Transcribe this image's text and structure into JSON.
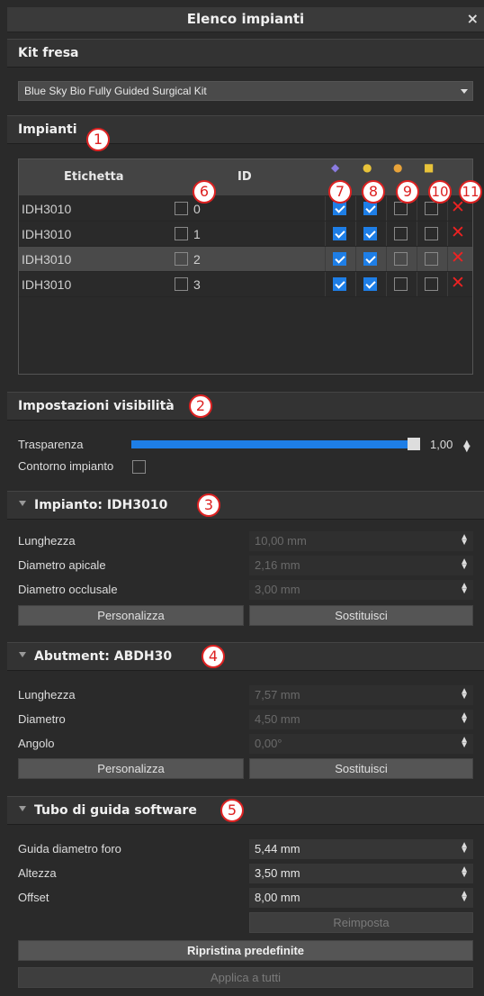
{
  "window": {
    "title": "Elenco impianti",
    "close_glyph": "×"
  },
  "kit_fresa": {
    "header": "Kit fresa",
    "selected": "Blue Sky Bio Fully Guided Surgical Kit"
  },
  "impianti": {
    "header": "Impianti",
    "columns": {
      "etichetta": "Etichetta",
      "id": "ID"
    },
    "rows": [
      {
        "label": "IDH3010",
        "id": "0",
        "c7": true,
        "c8": true,
        "c9": false,
        "c10": false,
        "selected": false
      },
      {
        "label": "IDH3010",
        "id": "1",
        "c7": true,
        "c8": true,
        "c9": false,
        "c10": false,
        "selected": false
      },
      {
        "label": "IDH3010",
        "id": "2",
        "c7": true,
        "c8": true,
        "c9": false,
        "c10": false,
        "selected": true
      },
      {
        "label": "IDH3010",
        "id": "3",
        "c7": true,
        "c8": true,
        "c9": false,
        "c10": false,
        "selected": false
      }
    ],
    "delete_glyph": "✕"
  },
  "visibility": {
    "header": "Impostazioni visibilità",
    "transparency_label": "Trasparenza",
    "transparency_value": "1,00",
    "transparency_level": 1.0,
    "contour_label": "Contorno impianto"
  },
  "implant": {
    "header": "Impianto: IDH3010",
    "fields": [
      {
        "label": "Lunghezza",
        "value": "10,00 mm"
      },
      {
        "label": "Diametro apicale",
        "value": "2,16 mm"
      },
      {
        "label": "Diametro occlusale",
        "value": "3,00 mm"
      }
    ],
    "customize": "Personalizza",
    "replace": "Sostituisci"
  },
  "abutment": {
    "header": "Abutment: ABDH30",
    "fields": [
      {
        "label": "Lunghezza",
        "value": "7,57 mm"
      },
      {
        "label": "Diametro",
        "value": "4,50 mm"
      },
      {
        "label": "Angolo",
        "value": "0,00°"
      }
    ],
    "customize": "Personalizza",
    "replace": "Sostituisci"
  },
  "guide_tube": {
    "header": "Tubo di guida software",
    "fields": [
      {
        "label": "Guida diametro foro",
        "value": "5,44 mm"
      },
      {
        "label": "Altezza",
        "value": "3,50 mm"
      },
      {
        "label": "Offset",
        "value": "8,00 mm"
      }
    ],
    "reset": "Reimposta"
  },
  "footer": {
    "restore_defaults": "Ripristina predefinite",
    "apply_all": "Applica a tutti"
  },
  "badges": [
    "1",
    "2",
    "3",
    "4",
    "5",
    "6",
    "7",
    "8",
    "9",
    "10",
    "11"
  ],
  "colors": {
    "accent": "#1e7ee6",
    "delete": "#e22222",
    "badge": "#dd2222"
  }
}
